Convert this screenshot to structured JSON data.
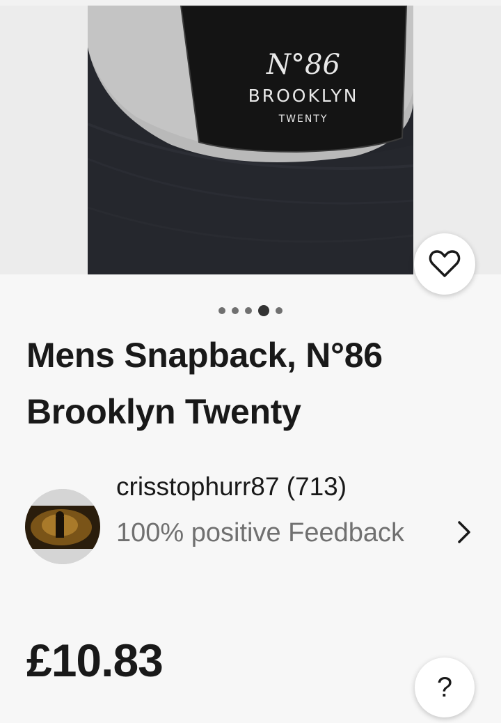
{
  "gallery": {
    "image_alt": "N°86 Brooklyn Twenty snapback cap",
    "label_lines": [
      "N°86",
      "BROOKLYN",
      "TWENTY"
    ],
    "dots_total": 5,
    "active_dot": 4
  },
  "listing": {
    "title": "Mens Snapback, N°86 Brooklyn Twenty",
    "price": "£10.83"
  },
  "seller": {
    "name": "crisstophurr87 (713)",
    "feedback": "100% positive Feedback"
  },
  "icons": {
    "watch": "heart-icon",
    "seller_more": "chevron-right-icon",
    "help": "question-mark-icon"
  },
  "help": {
    "label": "?"
  },
  "colors": {
    "text": "#191919",
    "secondary_text": "#707070",
    "background": "#f7f7f7"
  }
}
